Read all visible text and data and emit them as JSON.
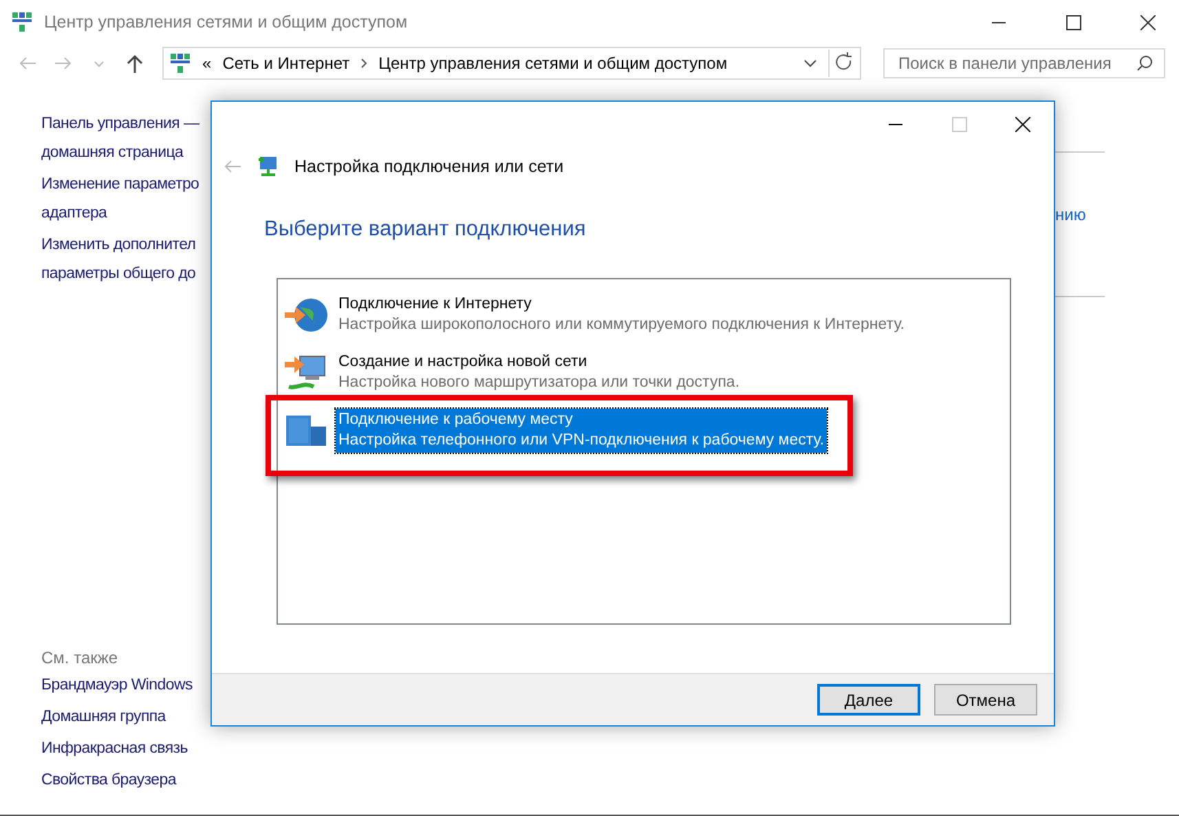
{
  "window": {
    "title": "Центр управления сетями и общим доступом"
  },
  "address_bar": {
    "overflow": "«",
    "crumbs": [
      "Сеть и Интернет",
      "Центр управления сетями и общим доступом"
    ]
  },
  "search": {
    "placeholder": "Поиск в панели управления"
  },
  "sidebar": {
    "links": [
      "Панель управления —\nдомашняя страница",
      "Изменение параметро\nадаптера",
      "Изменить дополнител\nпараметры общего до"
    ],
    "see_also_title": "См. также",
    "see_also": [
      "Брандмауэр Windows",
      "Домашняя группа",
      "Инфракрасная связь",
      "Свойства браузера"
    ]
  },
  "right_fragment": "нию",
  "dialog": {
    "title": "Настройка подключения или сети",
    "heading": "Выберите вариант подключения",
    "options": [
      {
        "kind": "globe",
        "title": "Подключение к Интернету",
        "description": "Настройка широкополосного или коммутируемого подключения к Интернету.",
        "selected": false
      },
      {
        "kind": "network",
        "title": "Создание и настройка новой сети",
        "description": "Настройка нового маршрутизатора или точки доступа.",
        "selected": false
      },
      {
        "kind": "workplace",
        "title": "Подключение к рабочему месту",
        "description": "Настройка телефонного или VPN-подключения к рабочему месту.",
        "selected": true
      }
    ],
    "buttons": [
      {
        "label": "Далее",
        "default": true
      },
      {
        "label": "Отмена",
        "default": false
      }
    ]
  }
}
